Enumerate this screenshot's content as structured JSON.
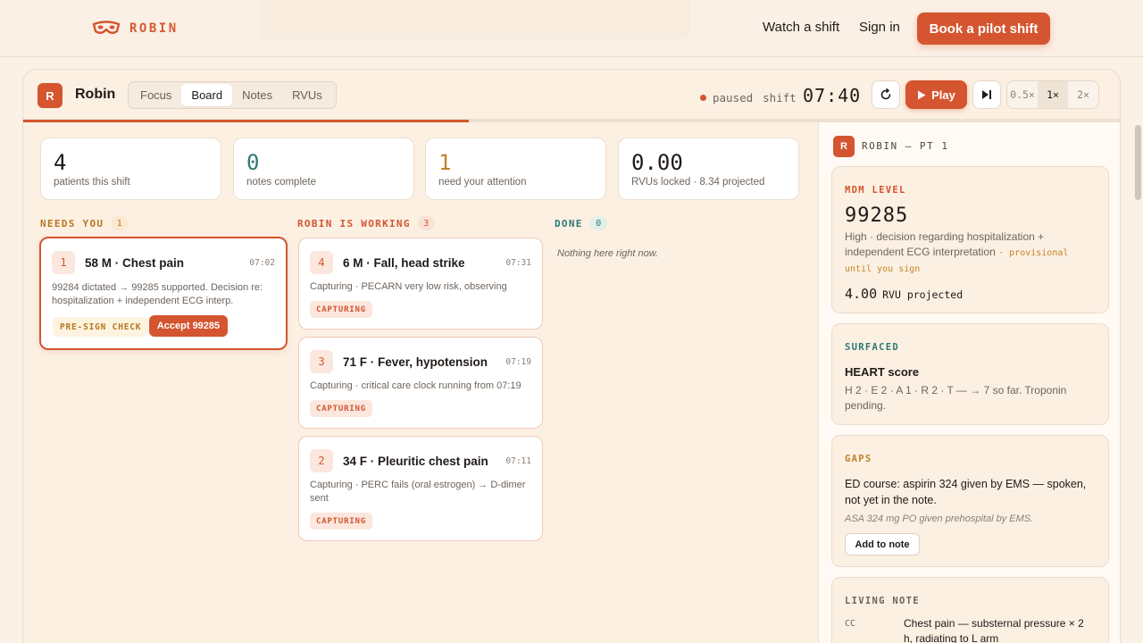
{
  "nav": {
    "brand": "ROBIN",
    "watch_label": "Watch a shift",
    "signin_label": "Sign in",
    "cta_label": "Book a pilot shift",
    "accent": "#d4552f"
  },
  "app": {
    "badge": "R",
    "name": "Robin",
    "tabs": [
      {
        "label": "Focus",
        "active": false
      },
      {
        "label": "Board",
        "active": true
      },
      {
        "label": "Notes",
        "active": false
      },
      {
        "label": "RVUs",
        "active": false
      }
    ],
    "status": "paused",
    "shift_label": "shift",
    "clock": "07:40",
    "play_label": "Play",
    "speeds": [
      "0.5×",
      "1×",
      "2×"
    ],
    "active_speed": "1×",
    "progress_fraction": 0.406
  },
  "stats": [
    {
      "value": "4",
      "label": "patients this shift",
      "color": "#1f1a17"
    },
    {
      "value": "0",
      "label": "notes complete",
      "color": "#2f7a73"
    },
    {
      "value": "1",
      "label": "need your attention",
      "color": "#c0822b"
    },
    {
      "value": "0.00",
      "label": "RVUs locked · 8.34 projected",
      "color": "#1f1a17"
    }
  ],
  "columns": {
    "needs_you": {
      "title": "NEEDS YOU",
      "count": "1",
      "color": "#b8781f",
      "count_bg": "#fbe8cf"
    },
    "robin_working": {
      "title": "ROBIN IS WORKING",
      "count": "3",
      "color": "#d4552f",
      "count_bg": "#f9e1d6"
    },
    "done": {
      "title": "DONE",
      "count": "0",
      "color": "#2f7a73",
      "count_bg": "#e0efe9",
      "empty": "Nothing here right now."
    }
  },
  "cards": {
    "needs": {
      "num": "1",
      "title": "58 M · Chest pain",
      "time": "07:02",
      "desc": "99284 dictated → 99285 supported. Decision re: hospitalization + independent ECG interp.",
      "tag": "PRE-SIGN CHECK",
      "accept": "Accept 99285"
    },
    "working": [
      {
        "num": "4",
        "title": "6 M · Fall, head strike",
        "time": "07:31",
        "desc": "Capturing · PECARN very low risk, observing",
        "tag": "CAPTURING"
      },
      {
        "num": "3",
        "title": "71 F · Fever, hypotension",
        "time": "07:19",
        "desc": "Capturing · critical care clock running from 07:19",
        "tag": "CAPTURING"
      },
      {
        "num": "2",
        "title": "34 F · Pleuritic chest pain",
        "time": "07:11",
        "desc": "Capturing · PERC fails (oral estrogen) → D-dimer sent",
        "tag": "CAPTURING"
      }
    ]
  },
  "panel": {
    "badge": "R",
    "title": "ROBIN — PT 1",
    "mdm": {
      "label": "MDM LEVEL",
      "code": "99285",
      "desc": "High · decision regarding hospitalization + independent ECG interpretation",
      "provisional": "· provisional until you sign",
      "rvu_value": "4.00",
      "rvu_label": "RVU projected"
    },
    "surfaced": {
      "label": "SURFACED",
      "title": "HEART score",
      "desc": "H 2 · E 2 · A 1 · R 2 · T — → 7 so far. Troponin pending."
    },
    "gaps": {
      "label": "GAPS",
      "desc": "ED course: aspirin 324 given by EMS — spoken, not yet in the note.",
      "quote": "ASA 324 mg PO given prehospital by EMS.",
      "add_label": "Add to note"
    },
    "living": {
      "label": "LIVING NOTE",
      "key": "CC",
      "value": "Chest pain — substernal pressure × 2 h, radiating to L arm"
    }
  }
}
